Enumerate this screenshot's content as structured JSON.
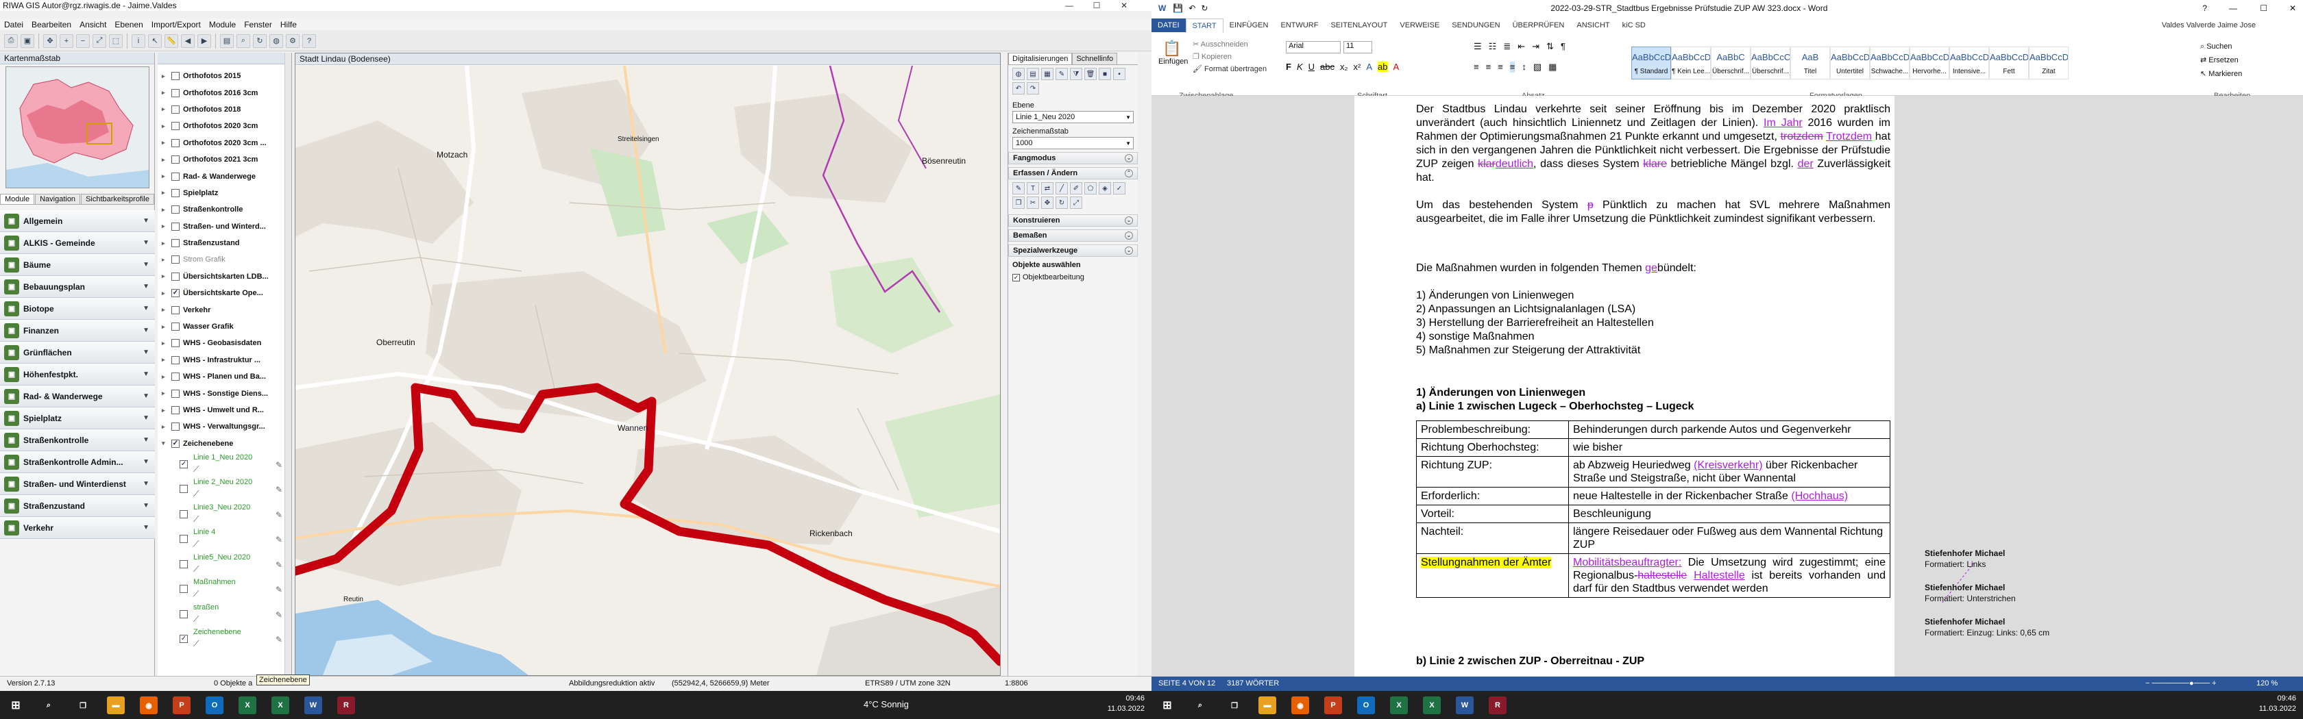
{
  "gis": {
    "title": "RIWA GIS Autor@rgz.riwagis.de - Jaime.Valdes",
    "menu": [
      "Datei",
      "Bearbeiten",
      "Ansicht",
      "Ebenen",
      "Import/Export",
      "Module",
      "Fenster",
      "Hilfe"
    ],
    "overview_title": "Kartenmaßstab",
    "tabs": [
      "Module",
      "Navigation",
      "Sichtbarkeitsprofile"
    ],
    "modules": [
      "Allgemein",
      "ALKIS - Gemeinde",
      "Bäume",
      "Bebauungsplan",
      "Biotope",
      "Finanzen",
      "Grünflächen",
      "Höhenfestpkt.",
      "Rad- & Wanderwege",
      "Spielplatz",
      "Straßenkontrolle",
      "Straßenkontrolle Admin...",
      "Straßen- und Winterdienst",
      "Straßenzustand",
      "Verkehr"
    ],
    "layers": [
      {
        "label": "Orthofotos 2015",
        "grey": false
      },
      {
        "label": "Orthofotos 2016 3cm",
        "grey": false
      },
      {
        "label": "Orthofotos 2018",
        "grey": false
      },
      {
        "label": "Orthofotos 2020 3cm",
        "grey": false
      },
      {
        "label": "Orthofotos 2020 3cm ...",
        "grey": false
      },
      {
        "label": "Orthofotos 2021 3cm",
        "grey": false
      },
      {
        "label": "Rad- & Wanderwege",
        "grey": false
      },
      {
        "label": "Spielplatz",
        "grey": false
      },
      {
        "label": "Straßenkontrolle",
        "grey": false
      },
      {
        "label": "Straßen- und Winterd...",
        "grey": false
      },
      {
        "label": "Straßenzustand",
        "grey": false
      },
      {
        "label": "Strom Grafik",
        "grey": true
      },
      {
        "label": "Übersichtskarten LDB...",
        "grey": false
      },
      {
        "label": "Übersichtskarte Ope...",
        "grey": false
      },
      {
        "label": "Verkehr",
        "grey": false
      },
      {
        "label": "Wasser Grafik",
        "grey": false
      },
      {
        "label": "WHS - Geobasisdaten",
        "grey": false
      },
      {
        "label": "WHS - Infrastruktur ...",
        "grey": false
      },
      {
        "label": "WHS - Planen und Ba...",
        "grey": false
      },
      {
        "label": "WHS - Sonstige Diens...",
        "grey": false
      },
      {
        "label": "WHS - Umwelt und R...",
        "grey": false
      },
      {
        "label": "WHS - Verwaltungsgr...",
        "grey": false
      },
      {
        "label": "Zeichenebene",
        "grey": false
      }
    ],
    "sublayers": [
      "Linie 1_Neu 2020",
      "Linie 2_Neu 2020",
      "Linie3_Neu 2020",
      "Linie 4",
      "Linie5_Neu 2020",
      "Maßnahmen",
      "straßen",
      "Zeichenebene"
    ],
    "map_title": "Stadt Lindau (Bodensee)",
    "places": [
      "Motzach",
      "Streitelsingen",
      "Bösenreutin",
      "Oberreutin",
      "Wannen",
      "Rickenbach",
      "Reutin"
    ],
    "rp_tabs": [
      "Digitalisierungen",
      "Schnellinfo"
    ],
    "ebene_label": "Ebene",
    "ebene_value": "Linie 1_Neu 2020",
    "zm_label": "Zeichenmaßstab",
    "zm_value": "1000",
    "sections": [
      "Fangmodus",
      "Erfassen / Ändern",
      "Konstruieren",
      "Bemaßen",
      "Spezialwerkzeuge"
    ],
    "objekte_label": "Objekte auswählen",
    "objektbearbeitung": "Objektbearbeitung",
    "status": {
      "version": "Version 2.7.13",
      "count": "0 Objekte a",
      "tooltip": "Zeichenebene",
      "reduction": "Abbildungsreduktion aktiv",
      "coords": "(552942,4, 5266659,9) Meter",
      "crs": "ETRS89 / UTM zone 32N",
      "scale": "1:8806"
    }
  },
  "word": {
    "title": "2022-03-29-STR_Stadtbus Ergebnisse Prüfstudie ZUP AW 323.docx - Word",
    "user": "Valdes Valverde Jaime Jose",
    "tabs": [
      "DATEI",
      "START",
      "EINFÜGEN",
      "ENTWURF",
      "SEITENLAYOUT",
      "VERWEISE",
      "SENDUNGEN",
      "ÜBERPRÜFEN",
      "ANSICHT",
      "kiC SD"
    ],
    "clip": {
      "paste": "Einfügen",
      "cut": "Ausschneiden",
      "copy": "Kopieren",
      "format": "Format übertragen"
    },
    "font": "Arial",
    "size": "11",
    "groups": [
      "Zwischenablage",
      "Schriftart",
      "Absatz",
      "Formatvorlagen",
      "Bearbeiten"
    ],
    "styles": [
      {
        "pv": "AaBbCcDc",
        "n": "¶ Standard"
      },
      {
        "pv": "AaBbCcDc",
        "n": "¶ Kein Lee..."
      },
      {
        "pv": "AaBbC",
        "n": "Überschrif..."
      },
      {
        "pv": "AaBbCcC",
        "n": "Überschrif..."
      },
      {
        "pv": "AaB",
        "n": "Titel"
      },
      {
        "pv": "AaBbCcD",
        "n": "Untertitel"
      },
      {
        "pv": "AaBbCcDc",
        "n": "Schwache..."
      },
      {
        "pv": "AaBbCcDc",
        "n": "Hervorhe..."
      },
      {
        "pv": "AaBbCcDc",
        "n": "Intensive..."
      },
      {
        "pv": "AaBbCcDc",
        "n": "Fett"
      },
      {
        "pv": "AaBbCcDc",
        "n": "Zitat"
      }
    ],
    "edit": [
      "Suchen",
      "Ersetzen",
      "Markieren"
    ],
    "p1": {
      "a": "Der Stadtbus Lindau verkehrte seit seiner Eröffnung bis im Dezember 2020 praktlisch unverändert (auch hinsichtlich Liniennetz und Zeitlagen der Linien). ",
      "ins1": "Im Jahr",
      "b": " 2016 wurden im Rahmen der Optimierungsmaßnahmen 21 Punkte erkannt und umgesetzt, ",
      "del1": "trotzdem",
      "c": " ",
      "ins2": "Trotzdem",
      "d": " hat sich in den vergangenen Jahren die Pünktlichkeit nicht verbessert. Die Ergebnisse der Prüfstudie ZUP zeigen ",
      "del2": "klar",
      "ins3": "deutlich",
      "e": ", dass dieses System ",
      "del3": "klare",
      "f": " betriebliche Mängel bzgl. ",
      "ins4": "der",
      "g": " Zuverlässigkeit hat."
    },
    "p2": {
      "a": "Um das bestehenden System ",
      "del": "p",
      "b": " Pünktlich zu machen hat SVL mehrere Maßnahmen ausgearbeitet, die im Falle ihrer Umsetzung die Pünktlichkeit zumindest signifikant verbessern."
    },
    "p3": {
      "a": "Die Maßnahmen wurden in folgenden Themen ",
      "ins": "ge",
      "b": "bündelt:"
    },
    "list": [
      "1)  Änderungen von Linienwegen",
      "2)  Anpassungen an Lichtsignalanlagen (LSA)",
      "3)  Herstellung der Barrierefreiheit an Haltestellen",
      "4)  sonstige Maßnahmen",
      "5)  Maßnahmen zur Steigerung der Attraktivität"
    ],
    "h1": "1)  Änderungen von Linienwegen",
    "h1a": "a)   Linie 1 zwischen Lugeck – Oberhochsteg – Lugeck",
    "table": [
      {
        "k": "Problembeschreibung:",
        "v": "Behinderungen durch parkende Autos und Gegenverkehr"
      },
      {
        "k": "Richtung Oberhochsteg:",
        "v": "wie bisher"
      },
      {
        "k": "Richtung ZUP:",
        "v": "ab Abzweig Heuriedweg ",
        "vi": "(Kreisverkehr)",
        "v2": " über Rickenbacher Straße und Steigstraße, nicht über Wannental"
      },
      {
        "k": "Erforderlich:",
        "v": "neue Haltestelle in der Rickenbacher Straße ",
        "vi": "(Hochhaus)",
        "v2": ""
      },
      {
        "k": "Vorteil:",
        "v": "Beschleunigung"
      },
      {
        "k": "Nachteil:",
        "v": "längere Reisedauer oder Fußweg aus dem Wannental Richtung ZUP"
      },
      {
        "k": "Stellungnahmen der Ämter",
        "v": "",
        "vi": "Mobilitätsbeauftragter:",
        "v2": " Die Umsetzung wird zugestimmt; eine Regionalbus-",
        "vd": "haltestelle",
        "v3": " ",
        "vi2": "Haltestelle",
        "v4": " ist bereits vorhanden und darf für den Stadtbus verwendet werden"
      }
    ],
    "h1b": "b)   Linie 2 zwischen ZUP - Oberreitnau - ZUP",
    "comments": [
      {
        "a": "Stiefenhofer Michael",
        "t": "Formatiert: Links"
      },
      {
        "a": "Stiefenhofer Michael",
        "t": "Formatiert: Unterstrichen"
      },
      {
        "a": "Stiefenhofer Michael",
        "t": "Formatiert: Einzug: Links:  0,65 cm"
      }
    ],
    "status": {
      "page": "SEITE 4 VON 12",
      "words": "3187 WÖRTER",
      "zoom": "120 %"
    }
  },
  "taskbar": {
    "weather": "4°C  Sonnig",
    "time": "09:46",
    "date": "11.03.2022"
  }
}
